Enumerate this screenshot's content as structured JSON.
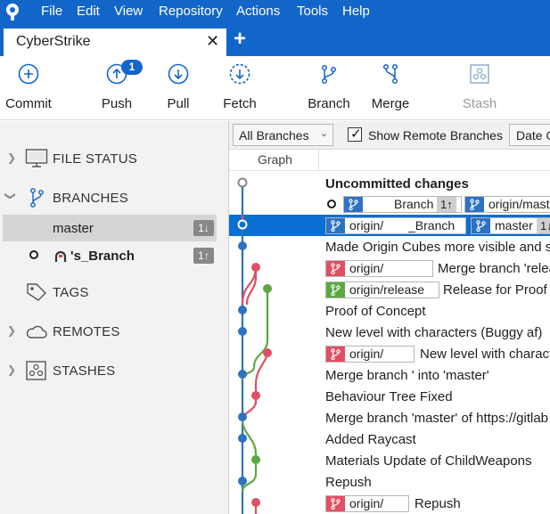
{
  "menu": [
    "File",
    "Edit",
    "View",
    "Repository",
    "Actions",
    "Tools",
    "Help"
  ],
  "tab": {
    "title": "CyberStrike",
    "close": "✕",
    "new": "+"
  },
  "toolbar": {
    "commit": "Commit",
    "push": "Push",
    "push_badge": "1",
    "pull": "Pull",
    "fetch": "Fetch",
    "branch": "Branch",
    "merge": "Merge",
    "stash": "Stash"
  },
  "sidebar": {
    "file_status": "FILE STATUS",
    "branches": "BRANCHES",
    "branch_items": [
      {
        "name": "master",
        "count": "1↓"
      },
      {
        "name": "'s_Branch",
        "count": "1↑"
      }
    ],
    "tags": "TAGS",
    "remotes": "REMOTES",
    "stashes": "STASHES"
  },
  "filter": {
    "branch_select": "All Branches",
    "show_remote": "Show Remote Branches",
    "date": "Date O"
  },
  "columns": {
    "graph": "Graph"
  },
  "commits": [
    {
      "message": "Uncommitted changes"
    },
    {
      "label1": "Branch",
      "label1_ahead": "1↑",
      "label2": "origin/maste"
    },
    {
      "label1": "origin/",
      "label1b": "_Branch",
      "label2": "master",
      "label2_ahead": "1↓"
    },
    {
      "message": "Made Origin Cubes more visible and se"
    },
    {
      "label": "origin/",
      "message": "Merge branch 'relea"
    },
    {
      "label": "origin/release",
      "message": "Release for Proof o"
    },
    {
      "message": "Proof of Concept"
    },
    {
      "message": "New level with characters (Buggy af)"
    },
    {
      "label": "origin/",
      "message": "New level with charact"
    },
    {
      "message": "Merge branch '     into 'master'"
    },
    {
      "message": "Behaviour Tree Fixed"
    },
    {
      "message": "Merge branch 'master' of https://gitlab"
    },
    {
      "message": "Added Raycast"
    },
    {
      "message": "Materials Update of ChildWeapons"
    },
    {
      "message": "Repush"
    },
    {
      "label": "origin/",
      "message": "Repush"
    }
  ],
  "colors": {
    "accent": "#1366c9",
    "selection": "#0a6fd3",
    "graph_blue": "#2d72c4",
    "graph_red": "#e04f63",
    "graph_green": "#5aa843"
  }
}
